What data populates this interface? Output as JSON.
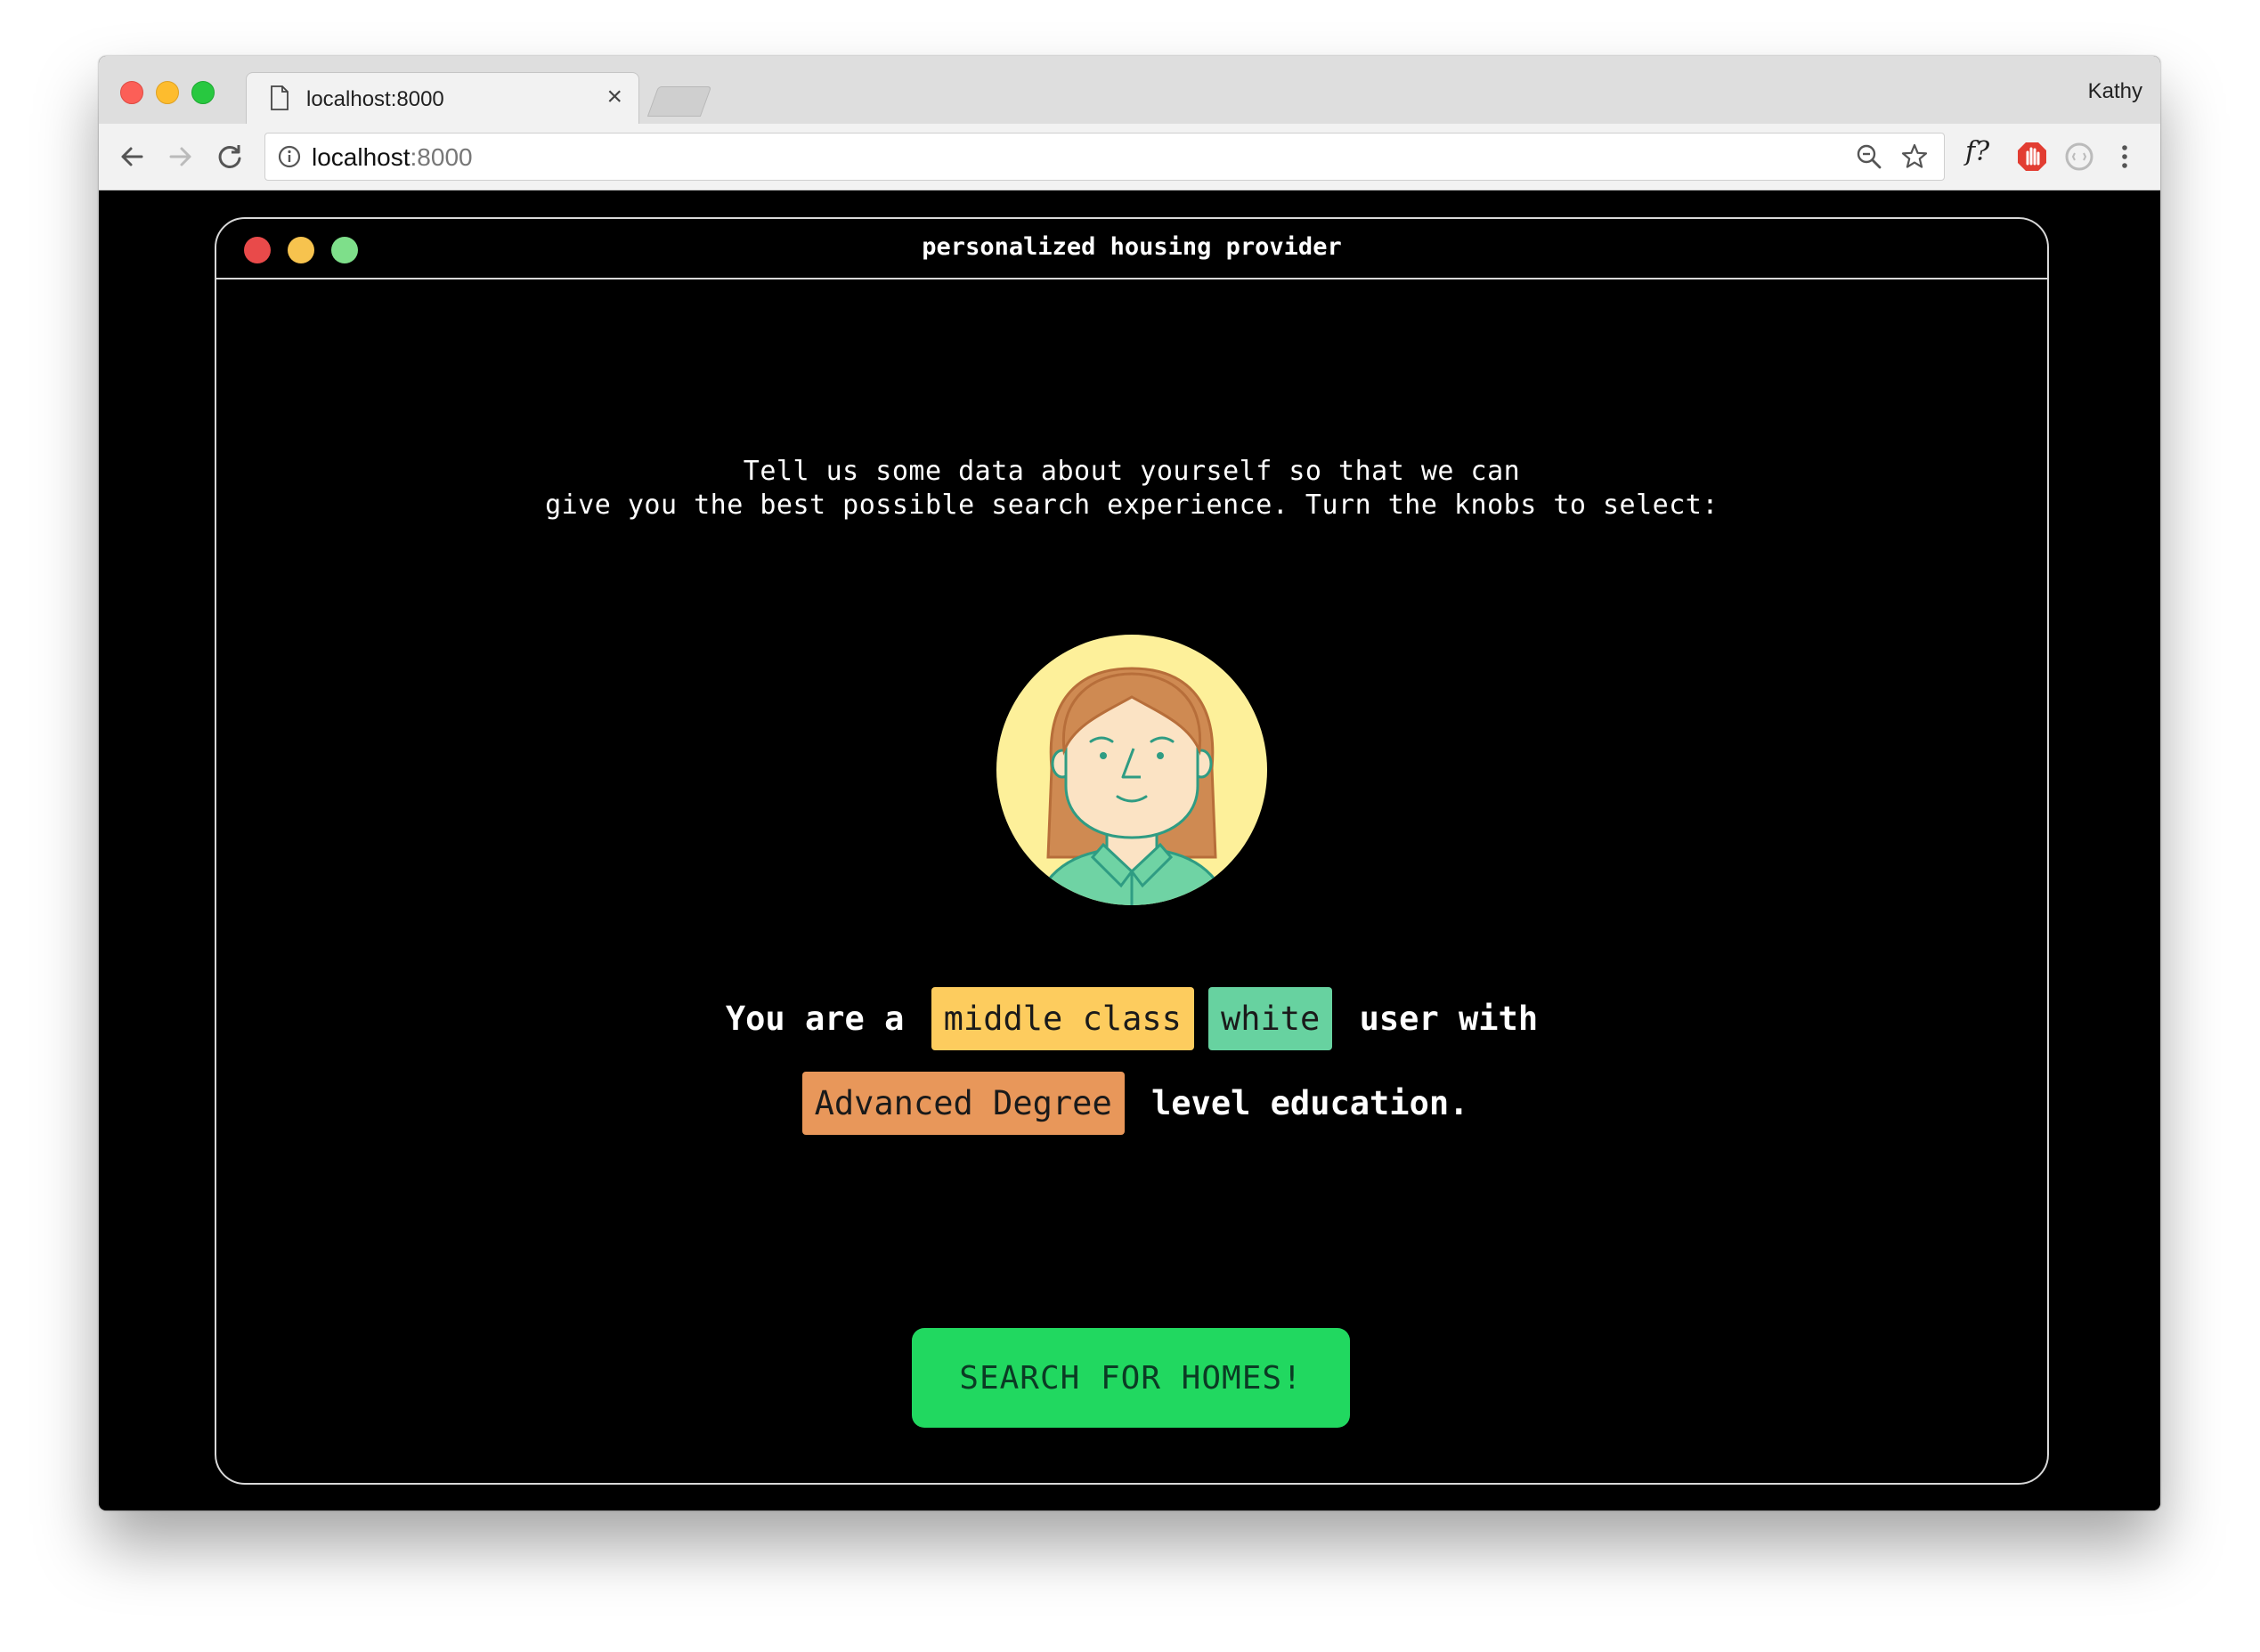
{
  "browser": {
    "tab_title": "localhost:8000",
    "tab_close": "×",
    "profile_name": "Kathy",
    "url_host": "localhost",
    "url_port": ":8000",
    "extension_fx_label": "f?"
  },
  "app": {
    "window_title": "personalized housing provider",
    "intro_line1": "Tell us some data about yourself so that we can",
    "intro_line2": "give you the best possible search experience. Turn the knobs to select:",
    "sentence": {
      "prefix": "You are a",
      "class_value": "middle class",
      "race_value": "white",
      "middle": "user with",
      "education_value": "Advanced Degree",
      "suffix": "level education."
    },
    "search_button": "SEARCH FOR HOMES!"
  },
  "colors": {
    "class_pill": "#fdcc5e",
    "race_pill": "#67d2a0",
    "education_pill": "#e8975a",
    "search_button": "#21d860",
    "avatar_bg": "#fdf09a",
    "hair": "#cf8a52",
    "shirt": "#6fd3a4"
  },
  "icons": [
    "page-icon",
    "back-arrow-icon",
    "forward-arrow-icon",
    "reload-icon",
    "info-icon",
    "zoom-out-icon",
    "star-icon",
    "stop-hand-icon",
    "circle-extension-icon",
    "more-vert-icon",
    "avatar-illustration"
  ]
}
